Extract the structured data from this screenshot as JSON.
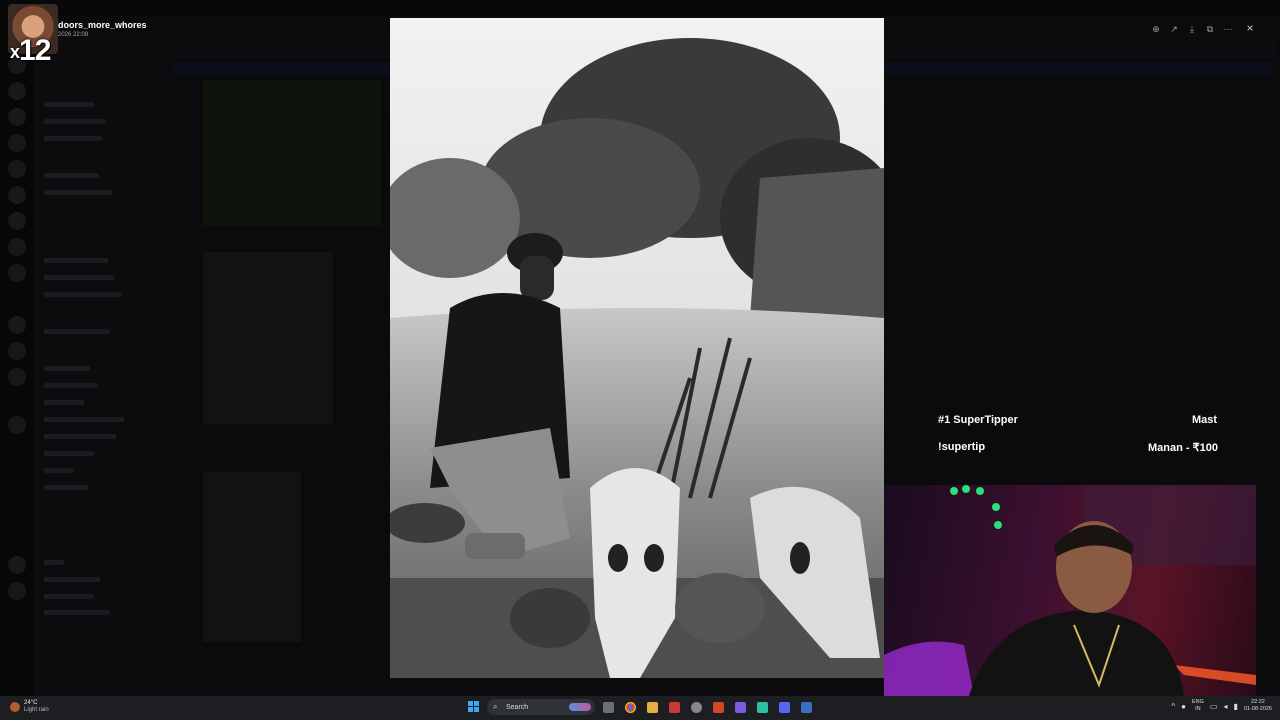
{
  "overlay": {
    "combo_prefix": "x",
    "combo_count": "12",
    "username": "doors_more_whores",
    "timestamp": "2026 22:08"
  },
  "viewer": {
    "toolbar_icons": [
      "zoom-in-icon",
      "share-icon",
      "download-icon",
      "open-external-icon",
      "more-icon"
    ],
    "close_icon": "×"
  },
  "supertip": {
    "rank_label": "#1 SuperTipper",
    "rank_value": "Mast",
    "command": "!supertip",
    "tipper": "Manan - ₹100"
  },
  "taskbar": {
    "weather_temp": "24°C",
    "weather_desc": "Light rain",
    "search_label": "Search",
    "lang_top": "ENG",
    "lang_bottom": "IN",
    "clock_time": "22:22",
    "clock_date": "01-08-2026"
  },
  "colors": {
    "accent": "#3ea8f5",
    "taskbar_bg": "#1c1e22"
  }
}
